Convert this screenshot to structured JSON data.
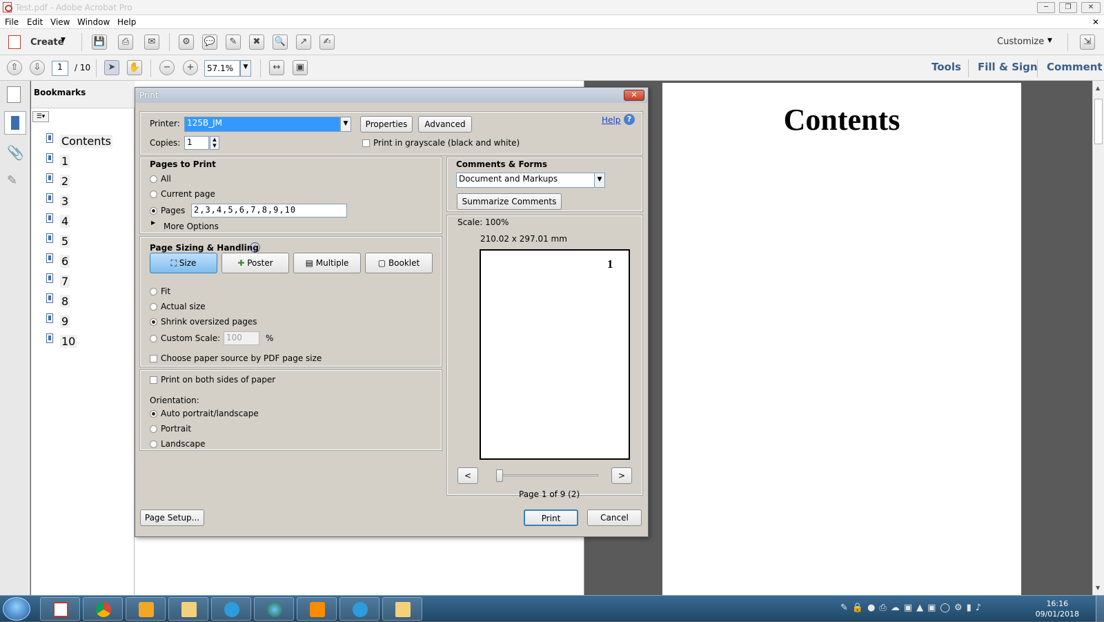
{
  "window": {
    "title": "Test.pdf - Adobe Acrobat Pro"
  },
  "menu": [
    "File",
    "Edit",
    "View",
    "Window",
    "Help"
  ],
  "toolbar": {
    "create_label": "Create",
    "customize_label": "Customize"
  },
  "nav": {
    "current_page": "1",
    "total_pages": "/ 10",
    "zoom": "57.1%"
  },
  "panes": {
    "tools": "Tools",
    "fill_sign": "Fill & Sign",
    "comment": "Comment"
  },
  "bookmarks": {
    "title": "Bookmarks",
    "items": [
      "Contents",
      "1",
      "2",
      "3",
      "4",
      "5",
      "6",
      "7",
      "8",
      "9",
      "10"
    ]
  },
  "document": {
    "heading": "Contents"
  },
  "print_dialog": {
    "title": "Print",
    "printer_label": "Printer:",
    "printer_value": "125B_JM",
    "properties_label": "Properties",
    "advanced_label": "Advanced",
    "help_label": "Help",
    "copies_label": "Copies:",
    "copies_value": "1",
    "grayscale_label": "Print in grayscale (black and white)",
    "pages_to_print": {
      "title": "Pages to Print",
      "all": "All",
      "current": "Current page",
      "pages": "Pages",
      "pages_value": "2,3,4,5,6,7,8,9,10",
      "more_options": "More Options"
    },
    "sizing": {
      "title": "Page Sizing & Handling",
      "tabs": [
        "Size",
        "Poster",
        "Multiple",
        "Booklet"
      ],
      "fit": "Fit",
      "actual": "Actual size",
      "shrink": "Shrink oversized pages",
      "custom": "Custom Scale:",
      "custom_value": "100",
      "percent": "%",
      "paper_source": "Choose paper source by PDF page size"
    },
    "duplex": {
      "both_sides": "Print on both sides of paper",
      "orientation": "Orientation:",
      "auto": "Auto portrait/landscape",
      "portrait": "Portrait",
      "landscape": "Landscape"
    },
    "comments_forms": {
      "title": "Comments & Forms",
      "value": "Document and Markups",
      "summarize": "Summarize Comments"
    },
    "preview": {
      "scale": "Scale: 100%",
      "dimensions": "210.02 x 297.01 mm",
      "page_number": "1",
      "prev": "<",
      "next": ">",
      "page_info": "Page 1 of 9 (2)"
    },
    "page_setup": "Page Setup...",
    "print": "Print",
    "cancel": "Cancel"
  },
  "taskbar": {
    "time": "16:16",
    "date": "09/01/2018"
  }
}
